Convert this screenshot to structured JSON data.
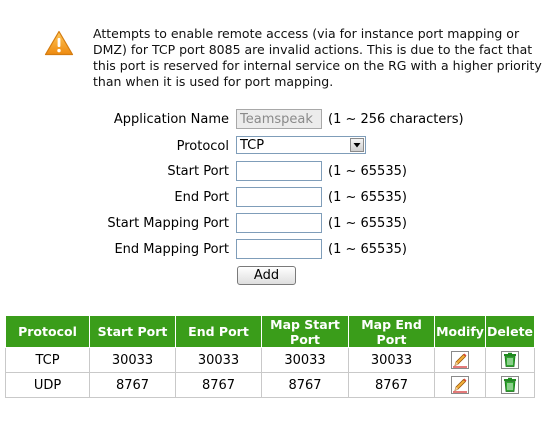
{
  "warning": {
    "icon": "warning-icon",
    "text": "Attempts to enable remote access (via for instance port mapping or DMZ) for TCP port 8085 are invalid actions. This is due to the fact that this port is reserved for internal service on the RG with a higher priority than when it is used for port mapping."
  },
  "form": {
    "application_name": {
      "label": "Application Name",
      "value": "Teamspeak",
      "hint": "(1 ~ 256 characters)"
    },
    "protocol": {
      "label": "Protocol",
      "value": "TCP"
    },
    "start_port": {
      "label": "Start Port",
      "value": "",
      "hint": "(1 ~ 65535)"
    },
    "end_port": {
      "label": "End Port",
      "value": "",
      "hint": "(1 ~ 65535)"
    },
    "start_mapping_port": {
      "label": "Start Mapping Port",
      "value": "",
      "hint": "(1 ~ 65535)"
    },
    "end_mapping_port": {
      "label": "End Mapping Port",
      "value": "",
      "hint": "(1 ~ 65535)"
    },
    "add_label": "Add"
  },
  "table": {
    "headers": [
      "Protocol",
      "Start Port",
      "End Port",
      "Map Start Port",
      "Map End Port",
      "Modify",
      "Delete"
    ],
    "rows": [
      {
        "protocol": "TCP",
        "start_port": "30033",
        "end_port": "30033",
        "map_start_port": "30033",
        "map_end_port": "30033"
      },
      {
        "protocol": "UDP",
        "start_port": "8767",
        "end_port": "8767",
        "map_start_port": "8767",
        "map_end_port": "8767"
      }
    ],
    "icons": {
      "modify": "edit-pencil-icon",
      "delete": "trash-icon"
    }
  },
  "colors": {
    "header_green": "#3a9d1a",
    "warning_orange": "#f2a31b"
  }
}
